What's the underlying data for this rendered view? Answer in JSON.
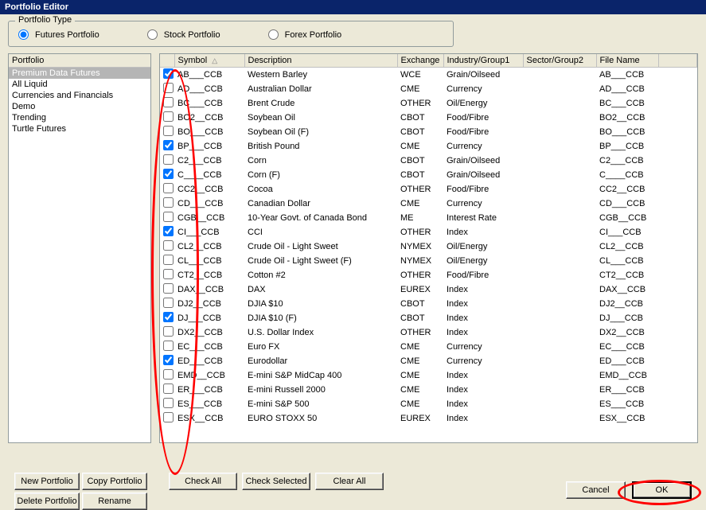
{
  "window": {
    "title": "Portfolio Editor"
  },
  "portfolioType": {
    "legend": "Portfolio Type",
    "options": [
      "Futures Portfolio",
      "Stock Portfolio",
      "Forex Portfolio"
    ],
    "selected": 0
  },
  "portfolio": {
    "header": "Portfolio",
    "items": [
      "Premium Data Futures",
      "All Liquid",
      "Currencies and Financials",
      "Demo",
      "Trending",
      "Turtle Futures"
    ],
    "selectedIndex": 0
  },
  "grid": {
    "columns": [
      "Symbol",
      "Description",
      "Exchange",
      "Industry/Group1",
      "Sector/Group2",
      "File Name"
    ],
    "sortCol": 0,
    "rows": [
      {
        "chk": true,
        "symbol": "AB___CCB",
        "desc": "Western Barley",
        "exch": "WCE",
        "ind": "Grain/Oilseed",
        "file": "AB___CCB"
      },
      {
        "chk": false,
        "symbol": "AD___CCB",
        "desc": "Australian Dollar",
        "exch": "CME",
        "ind": "Currency",
        "file": "AD___CCB"
      },
      {
        "chk": false,
        "symbol": "BC___CCB",
        "desc": "Brent Crude",
        "exch": "OTHER",
        "ind": "Oil/Energy",
        "file": "BC___CCB"
      },
      {
        "chk": false,
        "symbol": "BO2__CCB",
        "desc": "Soybean Oil",
        "exch": "CBOT",
        "ind": "Food/Fibre",
        "file": "BO2__CCB"
      },
      {
        "chk": false,
        "symbol": "BO___CCB",
        "desc": "Soybean Oil (F)",
        "exch": "CBOT",
        "ind": "Food/Fibre",
        "file": "BO___CCB"
      },
      {
        "chk": true,
        "symbol": "BP___CCB",
        "desc": "British Pound",
        "exch": "CME",
        "ind": "Currency",
        "file": "BP___CCB"
      },
      {
        "chk": false,
        "symbol": "C2___CCB",
        "desc": "Corn",
        "exch": "CBOT",
        "ind": "Grain/Oilseed",
        "file": "C2___CCB"
      },
      {
        "chk": true,
        "symbol": "C____CCB",
        "desc": "Corn (F)",
        "exch": "CBOT",
        "ind": "Grain/Oilseed",
        "file": "C____CCB"
      },
      {
        "chk": false,
        "symbol": "CC2__CCB",
        "desc": "Cocoa",
        "exch": "OTHER",
        "ind": "Food/Fibre",
        "file": "CC2__CCB"
      },
      {
        "chk": false,
        "symbol": "CD___CCB",
        "desc": "Canadian Dollar",
        "exch": "CME",
        "ind": "Currency",
        "file": "CD___CCB"
      },
      {
        "chk": false,
        "symbol": "CGB__CCB",
        "desc": "10-Year Govt. of Canada Bond",
        "exch": "ME",
        "ind": "Interest Rate",
        "file": "CGB__CCB"
      },
      {
        "chk": true,
        "symbol": "CI___CCB",
        "desc": "CCI",
        "exch": "OTHER",
        "ind": "Index",
        "file": "CI___CCB"
      },
      {
        "chk": false,
        "symbol": "CL2__CCB",
        "desc": "Crude Oil - Light Sweet",
        "exch": "NYMEX",
        "ind": "Oil/Energy",
        "file": "CL2__CCB"
      },
      {
        "chk": false,
        "symbol": "CL___CCB",
        "desc": "Crude Oil - Light Sweet (F)",
        "exch": "NYMEX",
        "ind": "Oil/Energy",
        "file": "CL___CCB"
      },
      {
        "chk": false,
        "symbol": "CT2__CCB",
        "desc": "Cotton #2",
        "exch": "OTHER",
        "ind": "Food/Fibre",
        "file": "CT2__CCB"
      },
      {
        "chk": false,
        "symbol": "DAX__CCB",
        "desc": "DAX",
        "exch": "EUREX",
        "ind": "Index",
        "file": "DAX__CCB"
      },
      {
        "chk": false,
        "symbol": "DJ2__CCB",
        "desc": "DJIA $10",
        "exch": "CBOT",
        "ind": "Index",
        "file": "DJ2__CCB"
      },
      {
        "chk": true,
        "symbol": "DJ___CCB",
        "desc": "DJIA $10 (F)",
        "exch": "CBOT",
        "ind": "Index",
        "file": "DJ___CCB"
      },
      {
        "chk": false,
        "symbol": "DX2__CCB",
        "desc": "U.S. Dollar Index",
        "exch": "OTHER",
        "ind": "Index",
        "file": "DX2__CCB"
      },
      {
        "chk": false,
        "symbol": "EC___CCB",
        "desc": "Euro FX",
        "exch": "CME",
        "ind": "Currency",
        "file": "EC___CCB"
      },
      {
        "chk": true,
        "symbol": "ED___CCB",
        "desc": "Eurodollar",
        "exch": "CME",
        "ind": "Currency",
        "file": "ED___CCB"
      },
      {
        "chk": false,
        "symbol": "EMD__CCB",
        "desc": "E-mini S&P MidCap 400",
        "exch": "CME",
        "ind": "Index",
        "file": "EMD__CCB"
      },
      {
        "chk": false,
        "symbol": "ER___CCB",
        "desc": "E-mini Russell 2000",
        "exch": "CME",
        "ind": "Index",
        "file": "ER___CCB"
      },
      {
        "chk": false,
        "symbol": "ES___CCB",
        "desc": "E-mini S&P 500",
        "exch": "CME",
        "ind": "Index",
        "file": "ES___CCB"
      },
      {
        "chk": false,
        "symbol": "ESX__CCB",
        "desc": "EURO STOXX 50",
        "exch": "EUREX",
        "ind": "Index",
        "file": "ESX__CCB"
      }
    ]
  },
  "buttons": {
    "newPortfolio": "New Portfolio",
    "copyPortfolio": "Copy Portfolio",
    "deletePortfolio": "Delete Portfolio",
    "rename": "Rename",
    "checkAll": "Check All",
    "checkSelected": "Check Selected",
    "clearAll": "Clear All",
    "cancel": "Cancel",
    "ok": "OK"
  }
}
